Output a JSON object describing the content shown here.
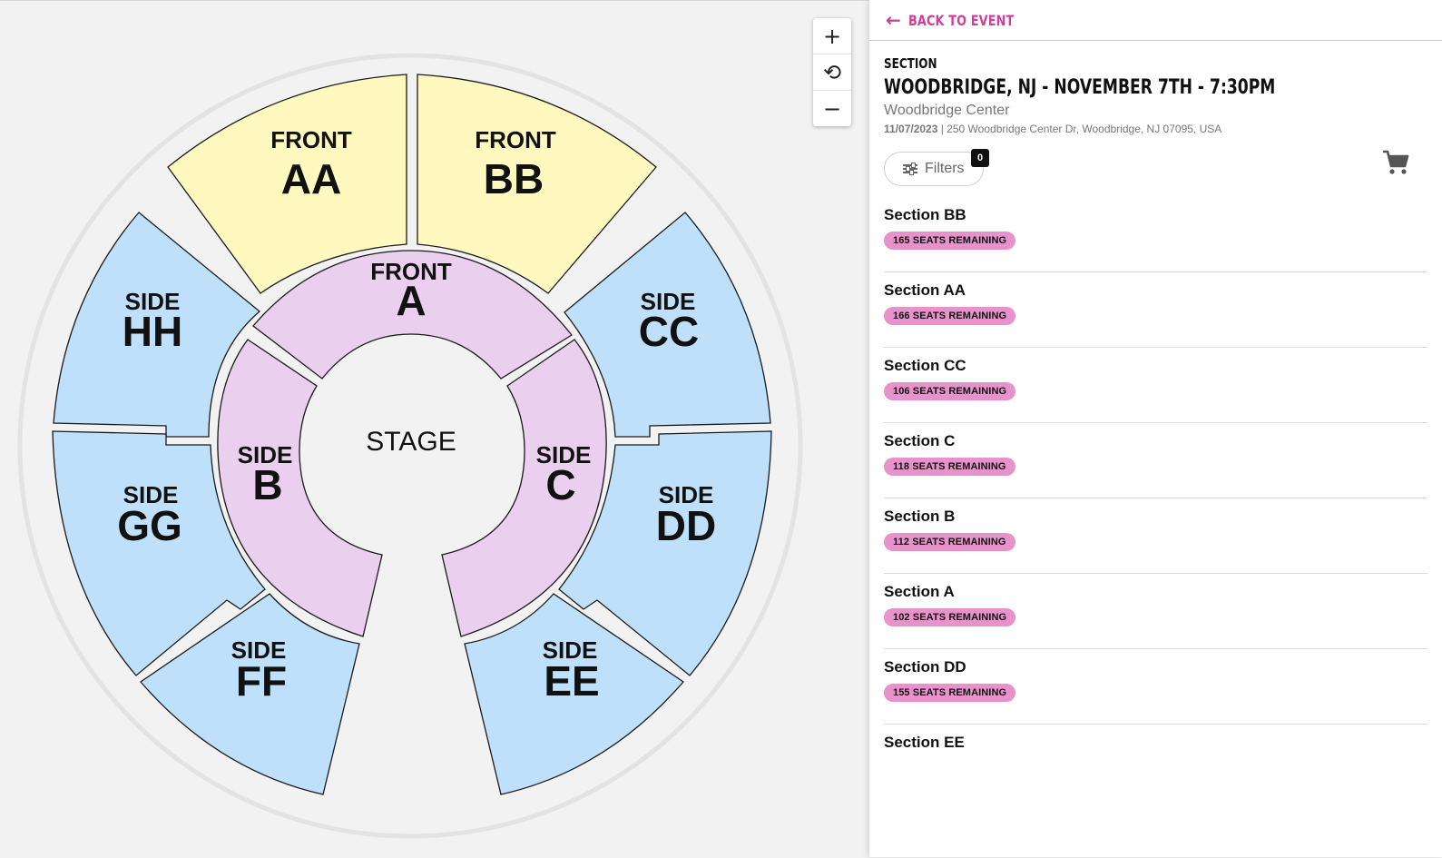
{
  "map": {
    "stage_label": "STAGE",
    "sections": [
      {
        "id": "front-aa",
        "line1": "FRONT",
        "line2": "AA"
      },
      {
        "id": "front-bb",
        "line1": "FRONT",
        "line2": "BB"
      },
      {
        "id": "front-a",
        "line1": "FRONT",
        "line2": "A"
      },
      {
        "id": "side-hh",
        "line1": "SIDE",
        "line2": "HH"
      },
      {
        "id": "side-cc",
        "line1": "SIDE",
        "line2": "CC"
      },
      {
        "id": "side-b",
        "line1": "SIDE",
        "line2": "B"
      },
      {
        "id": "side-c",
        "line1": "SIDE",
        "line2": "C"
      },
      {
        "id": "side-gg",
        "line1": "SIDE",
        "line2": "GG"
      },
      {
        "id": "side-dd",
        "line1": "SIDE",
        "line2": "DD"
      },
      {
        "id": "side-ff",
        "line1": "SIDE",
        "line2": "FF"
      },
      {
        "id": "side-ee",
        "line1": "SIDE",
        "line2": "EE"
      }
    ],
    "colors": {
      "front": "#fff8bf",
      "side": "#bfe0fb",
      "inner": "#ebcfee"
    }
  },
  "zoom": {
    "zoom_in": "+",
    "reset": "⟲",
    "zoom_out": "−"
  },
  "panel": {
    "back_label": "BACK TO EVENT",
    "kicker": "SECTION",
    "title": "WOODBRIDGE, NJ - NOVEMBER 7TH - 7:30PM",
    "venue": "Woodbridge Center",
    "date": "11/07/2023",
    "separator": " | ",
    "address": "250 Woodbridge Center Dr, Woodbridge, NJ 07095, USA",
    "filters_label": "Filters",
    "filters_count": "0",
    "accent_color": "#d13f9a",
    "pill_color": "#e892cc"
  },
  "sections_list": [
    {
      "name": "Section BB",
      "remaining": "165 SEATS REMAINING"
    },
    {
      "name": "Section AA",
      "remaining": "166 SEATS REMAINING"
    },
    {
      "name": "Section CC",
      "remaining": "106 SEATS REMAINING"
    },
    {
      "name": "Section C",
      "remaining": "118 SEATS REMAINING"
    },
    {
      "name": "Section B",
      "remaining": "112 SEATS REMAINING"
    },
    {
      "name": "Section A",
      "remaining": "102 SEATS REMAINING"
    },
    {
      "name": "Section DD",
      "remaining": "155 SEATS REMAINING"
    },
    {
      "name": "Section EE",
      "remaining": ""
    }
  ]
}
